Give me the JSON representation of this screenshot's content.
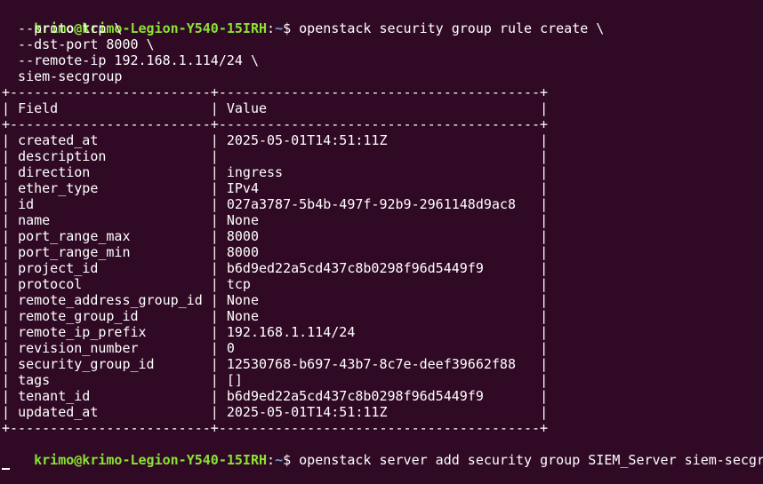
{
  "prompt": {
    "user_host": "krimo@krimo-Legion-Y540-15IRH",
    "separator": ":",
    "path": "~",
    "symbol": "$ "
  },
  "command1": {
    "line1": "openstack security group rule create \\",
    "line2": "  --proto tcp \\",
    "line3": "  --dst-port 8000 \\",
    "line4": "  --remote-ip 192.168.1.114/24 \\",
    "line5": "  siem-secgroup"
  },
  "table": {
    "border": "+-------------------------+----------------------------------------+",
    "headers": {
      "field": "Field",
      "value": "Value"
    },
    "rows": [
      {
        "field": "created_at",
        "value": "2025-05-01T14:51:11Z"
      },
      {
        "field": "description",
        "value": ""
      },
      {
        "field": "direction",
        "value": "ingress"
      },
      {
        "field": "ether_type",
        "value": "IPv4"
      },
      {
        "field": "id",
        "value": "027a3787-5b4b-497f-92b9-2961148d9ac8"
      },
      {
        "field": "name",
        "value": "None"
      },
      {
        "field": "port_range_max",
        "value": "8000"
      },
      {
        "field": "port_range_min",
        "value": "8000"
      },
      {
        "field": "project_id",
        "value": "b6d9ed22a5cd437c8b0298f96d5449f9"
      },
      {
        "field": "protocol",
        "value": "tcp"
      },
      {
        "field": "remote_address_group_id",
        "value": "None"
      },
      {
        "field": "remote_group_id",
        "value": "None"
      },
      {
        "field": "remote_ip_prefix",
        "value": "192.168.1.114/24"
      },
      {
        "field": "revision_number",
        "value": "0"
      },
      {
        "field": "security_group_id",
        "value": "12530768-b697-43b7-8c7e-deef39662f88"
      },
      {
        "field": "tags",
        "value": "[]"
      },
      {
        "field": "tenant_id",
        "value": "b6d9ed22a5cd437c8b0298f96d5449f9"
      },
      {
        "field": "updated_at",
        "value": "2025-05-01T14:51:11Z"
      }
    ]
  },
  "command2": "openstack server add security group SIEM_Server siem-secgroup",
  "colors": {
    "background": "#300a24",
    "prompt_user": "#8ae234",
    "prompt_path": "#729fcf",
    "text": "#ffffff"
  }
}
